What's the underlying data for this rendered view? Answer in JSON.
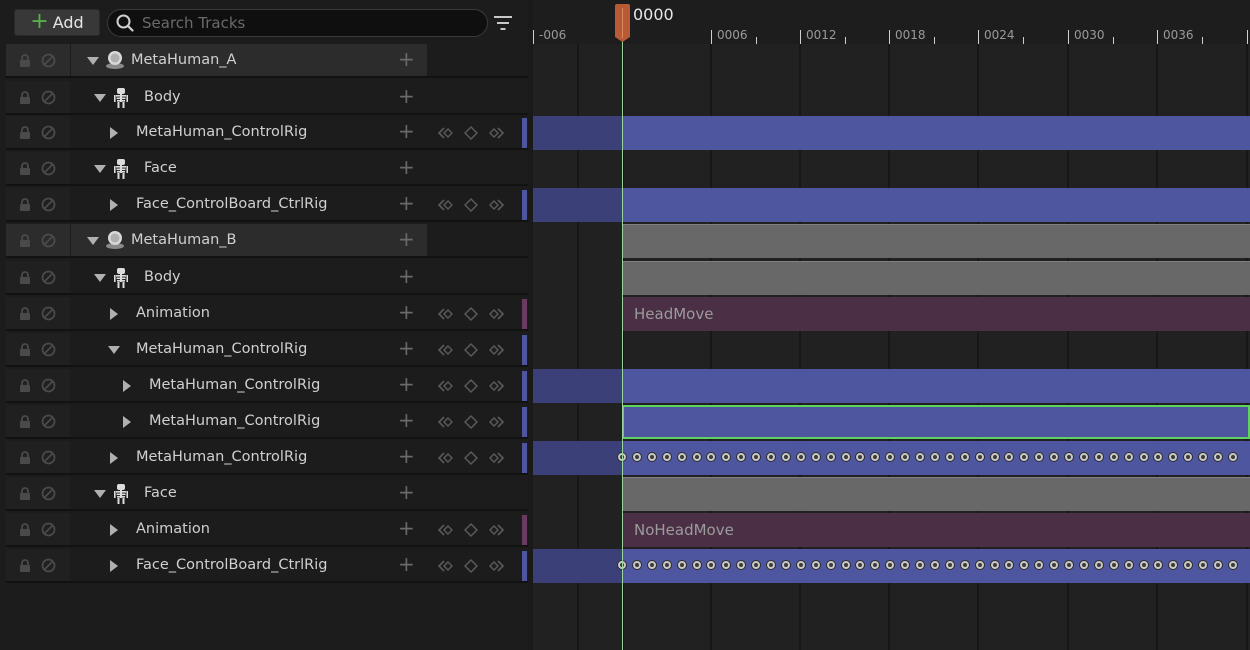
{
  "toolbar": {
    "add_label": "Add",
    "search_placeholder": "Search Tracks"
  },
  "tracks": [
    {
      "label": "MetaHuman_A",
      "icon": "actor-icon",
      "group": true,
      "expanded": true,
      "indent": 0,
      "has_keys": false
    },
    {
      "label": "Body",
      "icon": "skeleton-icon",
      "group": false,
      "expanded": true,
      "indent": 1,
      "has_keys": false
    },
    {
      "label": "MetaHuman_ControlRig",
      "icon": "",
      "group": false,
      "expanded": false,
      "indent": 2,
      "has_keys": true,
      "stripe": "#4f56a0"
    },
    {
      "label": "Face",
      "icon": "skeleton-icon",
      "group": false,
      "expanded": true,
      "indent": 1,
      "has_keys": false
    },
    {
      "label": "Face_ControlBoard_CtrlRig",
      "icon": "",
      "group": false,
      "expanded": false,
      "indent": 2,
      "has_keys": true,
      "stripe": "#4f56a0"
    },
    {
      "label": "MetaHuman_B",
      "icon": "actor-icon",
      "group": true,
      "expanded": true,
      "indent": 0,
      "has_keys": false
    },
    {
      "label": "Body",
      "icon": "skeleton-icon",
      "group": false,
      "expanded": true,
      "indent": 1,
      "has_keys": false
    },
    {
      "label": "Animation",
      "icon": "",
      "group": false,
      "expanded": false,
      "indent": 2,
      "has_keys": true,
      "stripe": "#6a3a60"
    },
    {
      "label": "MetaHuman_ControlRig",
      "icon": "",
      "group": false,
      "expanded": true,
      "indent": 2,
      "has_keys": true,
      "stripe": "#4f56a0"
    },
    {
      "label": "MetaHuman_ControlRig",
      "icon": "",
      "group": false,
      "expanded": false,
      "indent": 3,
      "has_keys": true,
      "stripe": "#4f56a0"
    },
    {
      "label": "MetaHuman_ControlRig",
      "icon": "",
      "group": false,
      "expanded": false,
      "indent": 3,
      "has_keys": true,
      "stripe": "#4f56a0"
    },
    {
      "label": "MetaHuman_ControlRig",
      "icon": "",
      "group": false,
      "expanded": false,
      "indent": 2,
      "has_keys": true,
      "stripe": "#4f56a0"
    },
    {
      "label": "Face",
      "icon": "skeleton-icon",
      "group": false,
      "expanded": true,
      "indent": 1,
      "has_keys": false
    },
    {
      "label": "Animation",
      "icon": "",
      "group": false,
      "expanded": false,
      "indent": 2,
      "has_keys": true,
      "stripe": "#6a3a60"
    },
    {
      "label": "Face_ControlBoard_CtrlRig",
      "icon": "",
      "group": false,
      "expanded": false,
      "indent": 2,
      "has_keys": true,
      "stripe": "#4f56a0"
    }
  ],
  "timeline": {
    "current_frame": "0000",
    "tick_labels": [
      "-006",
      "0006",
      "0012",
      "0018",
      "0024",
      "0030",
      "0036"
    ],
    "sections": [
      {
        "track": 2,
        "kind": "control-rig",
        "label": ""
      },
      {
        "track": 4,
        "kind": "control-rig",
        "label": ""
      },
      {
        "track": 5,
        "kind": "skeletal",
        "label": ""
      },
      {
        "track": 6,
        "kind": "skeletal",
        "label": ""
      },
      {
        "track": 7,
        "kind": "animation",
        "label": "HeadMove"
      },
      {
        "track": 9,
        "kind": "control-rig",
        "label": ""
      },
      {
        "track": 10,
        "kind": "control-rig-selected",
        "label": ""
      },
      {
        "track": 11,
        "kind": "keys",
        "label": ""
      },
      {
        "track": 12,
        "kind": "skeletal",
        "label": ""
      },
      {
        "track": 13,
        "kind": "animation",
        "label": "NoHeadMove"
      },
      {
        "track": 14,
        "kind": "keys",
        "label": ""
      }
    ],
    "colors": {
      "control_rig": "#4f56a0",
      "animation": "#4a2f45",
      "skeletal": "#686868",
      "selection": "#5fd35f",
      "playhead": "#b85a36"
    }
  }
}
